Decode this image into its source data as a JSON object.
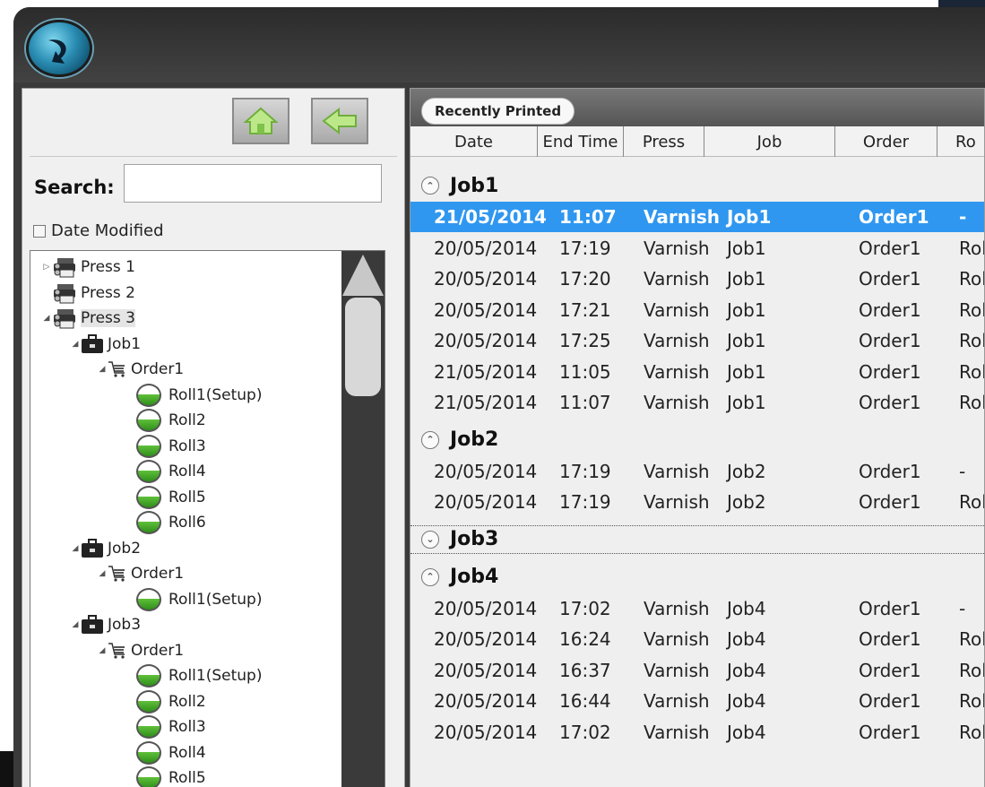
{
  "left": {
    "search_label": "Search:",
    "search_value": "",
    "date_modified_label": "Date Modified",
    "tree": [
      {
        "depth": 0,
        "type": "press",
        "label": "Press 1",
        "arrow": "▷",
        "selected": false
      },
      {
        "depth": 0,
        "type": "press",
        "label": "Press 2",
        "arrow": "",
        "selected": false
      },
      {
        "depth": 0,
        "type": "press",
        "label": "Press 3",
        "arrow": "◢",
        "selected": true
      },
      {
        "depth": 1,
        "type": "job",
        "label": "Job1",
        "arrow": "◢",
        "selected": false
      },
      {
        "depth": 2,
        "type": "order",
        "label": "Order1",
        "arrow": "◢",
        "selected": false
      },
      {
        "depth": 3,
        "type": "roll",
        "label": "Roll1(Setup)",
        "arrow": "",
        "selected": false
      },
      {
        "depth": 3,
        "type": "roll",
        "label": "Roll2",
        "arrow": "",
        "selected": false
      },
      {
        "depth": 3,
        "type": "roll",
        "label": "Roll3",
        "arrow": "",
        "selected": false
      },
      {
        "depth": 3,
        "type": "roll",
        "label": "Roll4",
        "arrow": "",
        "selected": false
      },
      {
        "depth": 3,
        "type": "roll",
        "label": "Roll5",
        "arrow": "",
        "selected": false
      },
      {
        "depth": 3,
        "type": "roll",
        "label": "Roll6",
        "arrow": "",
        "selected": false
      },
      {
        "depth": 1,
        "type": "job",
        "label": "Job2",
        "arrow": "◢",
        "selected": false
      },
      {
        "depth": 2,
        "type": "order",
        "label": "Order1",
        "arrow": "◢",
        "selected": false
      },
      {
        "depth": 3,
        "type": "roll",
        "label": "Roll1(Setup)",
        "arrow": "",
        "selected": false
      },
      {
        "depth": 1,
        "type": "job",
        "label": "Job3",
        "arrow": "◢",
        "selected": false
      },
      {
        "depth": 2,
        "type": "order",
        "label": "Order1",
        "arrow": "◢",
        "selected": false
      },
      {
        "depth": 3,
        "type": "roll",
        "label": "Roll1(Setup)",
        "arrow": "",
        "selected": false
      },
      {
        "depth": 3,
        "type": "roll",
        "label": "Roll2",
        "arrow": "",
        "selected": false
      },
      {
        "depth": 3,
        "type": "roll",
        "label": "Roll3",
        "arrow": "",
        "selected": false
      },
      {
        "depth": 3,
        "type": "roll",
        "label": "Roll4",
        "arrow": "",
        "selected": false
      },
      {
        "depth": 3,
        "type": "roll",
        "label": "Roll5",
        "arrow": "",
        "selected": false
      }
    ]
  },
  "right": {
    "tab_label": "Recently Printed",
    "columns": [
      "Date",
      "End Time",
      "Press",
      "Job",
      "Order",
      "Ro"
    ],
    "groups": [
      {
        "name": "Job1",
        "expanded": true,
        "focused": false,
        "rows": [
          {
            "date": "21/05/2014",
            "time": "11:07",
            "press": "Varnish",
            "job": "Job1",
            "order": "Order1",
            "roll": "-",
            "selected": true
          },
          {
            "date": "20/05/2014",
            "time": "17:19",
            "press": "Varnish",
            "job": "Job1",
            "order": "Order1",
            "roll": "Rol",
            "selected": false
          },
          {
            "date": "20/05/2014",
            "time": "17:20",
            "press": "Varnish",
            "job": "Job1",
            "order": "Order1",
            "roll": "Rol",
            "selected": false
          },
          {
            "date": "20/05/2014",
            "time": "17:21",
            "press": "Varnish",
            "job": "Job1",
            "order": "Order1",
            "roll": "Rol",
            "selected": false
          },
          {
            "date": "20/05/2014",
            "time": "17:25",
            "press": "Varnish",
            "job": "Job1",
            "order": "Order1",
            "roll": "Rol",
            "selected": false
          },
          {
            "date": "21/05/2014",
            "time": "11:05",
            "press": "Varnish",
            "job": "Job1",
            "order": "Order1",
            "roll": "Rol",
            "selected": false
          },
          {
            "date": "21/05/2014",
            "time": "11:07",
            "press": "Varnish",
            "job": "Job1",
            "order": "Order1",
            "roll": "Rol",
            "selected": false
          }
        ]
      },
      {
        "name": "Job2",
        "expanded": true,
        "focused": false,
        "rows": [
          {
            "date": "20/05/2014",
            "time": "17:19",
            "press": "Varnish",
            "job": "Job2",
            "order": "Order1",
            "roll": "-",
            "selected": false
          },
          {
            "date": "20/05/2014",
            "time": "17:19",
            "press": "Varnish",
            "job": "Job2",
            "order": "Order1",
            "roll": "Rol",
            "selected": false
          }
        ]
      },
      {
        "name": "Job3",
        "expanded": false,
        "focused": true,
        "rows": []
      },
      {
        "name": "Job4",
        "expanded": true,
        "focused": false,
        "rows": [
          {
            "date": "20/05/2014",
            "time": "17:02",
            "press": "Varnish",
            "job": "Job4",
            "order": "Order1",
            "roll": "-",
            "selected": false
          },
          {
            "date": "20/05/2014",
            "time": "16:24",
            "press": "Varnish",
            "job": "Job4",
            "order": "Order1",
            "roll": "Rol",
            "selected": false
          },
          {
            "date": "20/05/2014",
            "time": "16:37",
            "press": "Varnish",
            "job": "Job4",
            "order": "Order1",
            "roll": "Rol",
            "selected": false
          },
          {
            "date": "20/05/2014",
            "time": "16:44",
            "press": "Varnish",
            "job": "Job4",
            "order": "Order1",
            "roll": "Rol",
            "selected": false
          },
          {
            "date": "20/05/2014",
            "time": "17:02",
            "press": "Varnish",
            "job": "Job4",
            "order": "Order1",
            "roll": "Rol",
            "selected": false
          }
        ]
      }
    ]
  },
  "colors": {
    "selection": "#2f97f0",
    "roll_green": "#2f8f1a",
    "chrome_dark": "#3a3a3a"
  }
}
